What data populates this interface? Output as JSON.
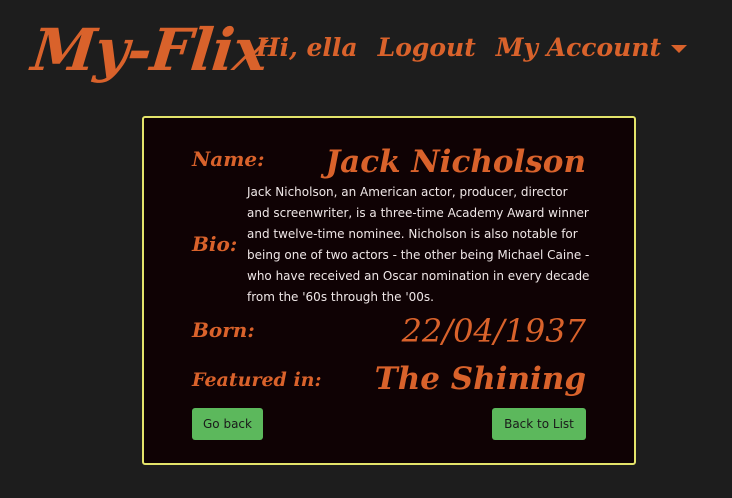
{
  "header": {
    "brand": "My-Flix",
    "greeting": "Hi, ella",
    "logout_label": "Logout",
    "account_label": "My Account"
  },
  "director": {
    "name_label": "Name:",
    "name": "Jack Nicholson",
    "bio_label": "Bio:",
    "bio": "Jack Nicholson, an American actor, producer, director and screenwriter, is a three-time Academy Award winner and twelve-time nominee. Nicholson is also notable for being one of two actors - the other being Michael Caine - who have received an Oscar nomination in every decade from the '60s through the '00s.",
    "born_label": "Born:",
    "born": "22/04/1937",
    "featured_label": "Featured in:",
    "featured": "The Shining"
  },
  "actions": {
    "back_label": "Go back",
    "list_label": "Back to List"
  },
  "colors": {
    "accent": "#d9622b",
    "card_border": "#e3e36a",
    "card_bg": "#0f0204",
    "page_bg": "#1d1d1d",
    "button_bg": "#5cb85c"
  },
  "icons": {
    "dropdown": "caret-down-icon"
  }
}
